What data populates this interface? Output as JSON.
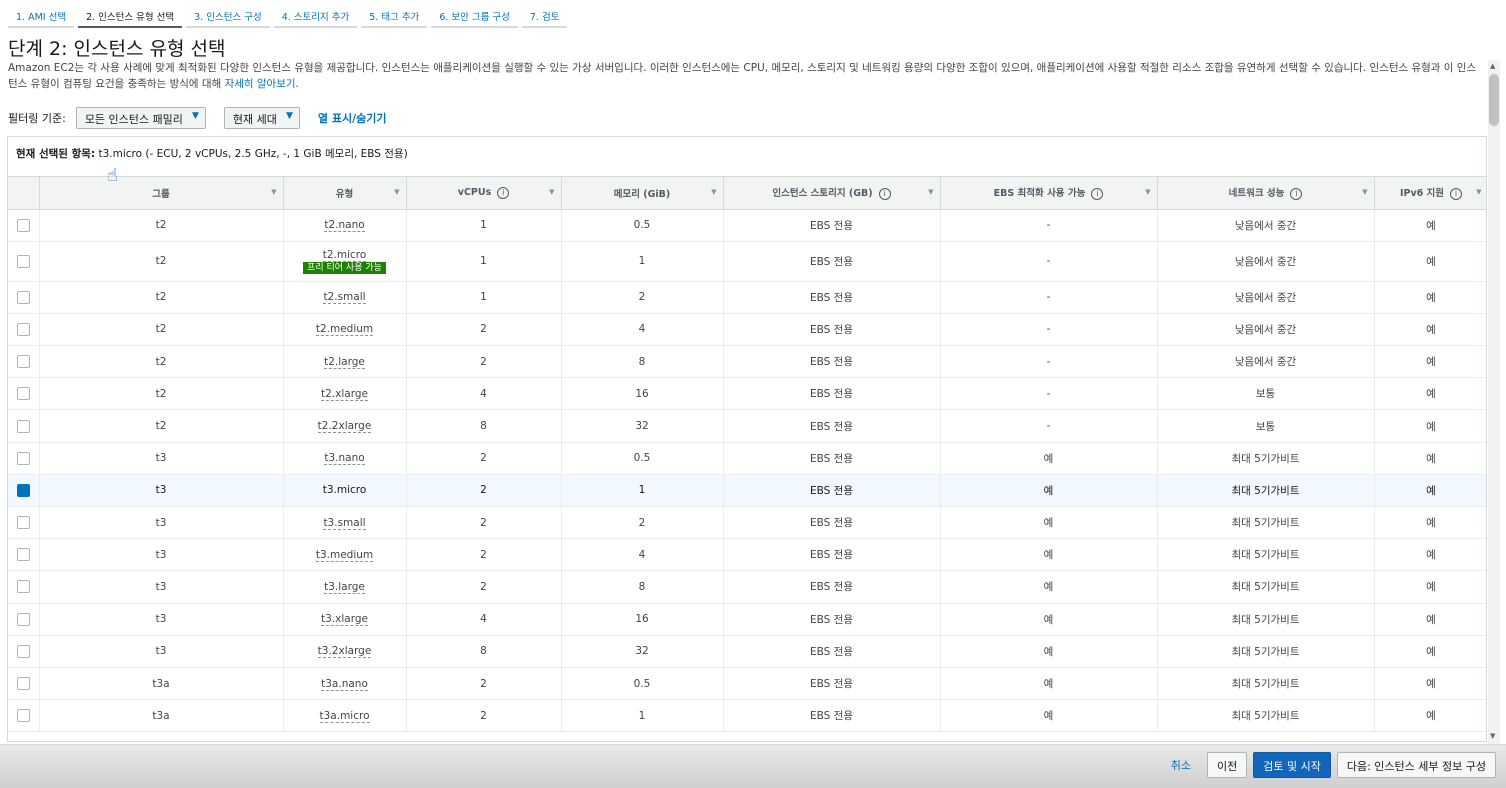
{
  "tabs": [
    "1. AMI 선택",
    "2. 인스턴스 유형 선택",
    "3. 인스턴스 구성",
    "4. 스토리지 추가",
    "5. 태그 추가",
    "6. 보안 그룹 구성",
    "7. 검토"
  ],
  "title": "단계 2: 인스턴스 유형 선택",
  "description": {
    "text": "Amazon EC2는 각 사용 사례에 맞게 최적화된 다양한 인스턴스 유형을 제공합니다. 인스턴스는 애플리케이션을 실행할 수 있는 가상 서버입니다. 이러한 인스턴스에는 CPU, 메모리, 스토리지 및 네트워킹 용량의 다양한 조합이 있으며, 애플리케이션에 사용할 적절한 리소스 조합을 유연하게 선택할 수 있습니다. 인스턴스 유형과 이 인스턴스 유형이 컴퓨팅 요건을 충족하는 방식에 대해 ",
    "link": "자세히 알아보기",
    "tail": "."
  },
  "filter": {
    "label": "필터링 기준:",
    "family": "모든 인스턴스 패밀리",
    "generation": "현재 세대",
    "toggle_columns": "열 표시/숨기기"
  },
  "selection": {
    "label": "현재 선택된 항목:",
    "value": "t3.micro (- ECU, 2 vCPUs, 2.5 GHz, -, 1 GiB 메모리, EBS 전용)"
  },
  "columns": [
    "그룹",
    "유형",
    "vCPUs",
    "메모리 (GiB)",
    "인스턴스 스토리지 (GB)",
    "EBS 최적화 사용 가능",
    "네트워크 성능",
    "IPv6 지원"
  ],
  "info_icon": "i",
  "free_tier_badge": "프리 티어 사용 가능",
  "rows": [
    {
      "group": "t2",
      "type": "t2.nano",
      "vcpus": "1",
      "memory": "0.5",
      "storage": "EBS 전용",
      "ebs": "-",
      "network": "낮음에서 중간",
      "ipv6": "예",
      "selected": false,
      "free": false
    },
    {
      "group": "t2",
      "type": "t2.micro",
      "vcpus": "1",
      "memory": "1",
      "storage": "EBS 전용",
      "ebs": "-",
      "network": "낮음에서 중간",
      "ipv6": "예",
      "selected": false,
      "free": true
    },
    {
      "group": "t2",
      "type": "t2.small",
      "vcpus": "1",
      "memory": "2",
      "storage": "EBS 전용",
      "ebs": "-",
      "network": "낮음에서 중간",
      "ipv6": "예",
      "selected": false,
      "free": false
    },
    {
      "group": "t2",
      "type": "t2.medium",
      "vcpus": "2",
      "memory": "4",
      "storage": "EBS 전용",
      "ebs": "-",
      "network": "낮음에서 중간",
      "ipv6": "예",
      "selected": false,
      "free": false
    },
    {
      "group": "t2",
      "type": "t2.large",
      "vcpus": "2",
      "memory": "8",
      "storage": "EBS 전용",
      "ebs": "-",
      "network": "낮음에서 중간",
      "ipv6": "예",
      "selected": false,
      "free": false
    },
    {
      "group": "t2",
      "type": "t2.xlarge",
      "vcpus": "4",
      "memory": "16",
      "storage": "EBS 전용",
      "ebs": "-",
      "network": "보통",
      "ipv6": "예",
      "selected": false,
      "free": false
    },
    {
      "group": "t2",
      "type": "t2.2xlarge",
      "vcpus": "8",
      "memory": "32",
      "storage": "EBS 전용",
      "ebs": "-",
      "network": "보통",
      "ipv6": "예",
      "selected": false,
      "free": false
    },
    {
      "group": "t3",
      "type": "t3.nano",
      "vcpus": "2",
      "memory": "0.5",
      "storage": "EBS 전용",
      "ebs": "예",
      "network": "최대 5기가비트",
      "ipv6": "예",
      "selected": false,
      "free": false
    },
    {
      "group": "t3",
      "type": "t3.micro",
      "vcpus": "2",
      "memory": "1",
      "storage": "EBS 전용",
      "ebs": "예",
      "network": "최대 5기가비트",
      "ipv6": "예",
      "selected": true,
      "free": false
    },
    {
      "group": "t3",
      "type": "t3.small",
      "vcpus": "2",
      "memory": "2",
      "storage": "EBS 전용",
      "ebs": "예",
      "network": "최대 5기가비트",
      "ipv6": "예",
      "selected": false,
      "free": false
    },
    {
      "group": "t3",
      "type": "t3.medium",
      "vcpus": "2",
      "memory": "4",
      "storage": "EBS 전용",
      "ebs": "예",
      "network": "최대 5기가비트",
      "ipv6": "예",
      "selected": false,
      "free": false
    },
    {
      "group": "t3",
      "type": "t3.large",
      "vcpus": "2",
      "memory": "8",
      "storage": "EBS 전용",
      "ebs": "예",
      "network": "최대 5기가비트",
      "ipv6": "예",
      "selected": false,
      "free": false
    },
    {
      "group": "t3",
      "type": "t3.xlarge",
      "vcpus": "4",
      "memory": "16",
      "storage": "EBS 전용",
      "ebs": "예",
      "network": "최대 5기가비트",
      "ipv6": "예",
      "selected": false,
      "free": false
    },
    {
      "group": "t3",
      "type": "t3.2xlarge",
      "vcpus": "8",
      "memory": "32",
      "storage": "EBS 전용",
      "ebs": "예",
      "network": "최대 5기가비트",
      "ipv6": "예",
      "selected": false,
      "free": false
    },
    {
      "group": "t3a",
      "type": "t3a.nano",
      "vcpus": "2",
      "memory": "0.5",
      "storage": "EBS 전용",
      "ebs": "예",
      "network": "최대 5기가비트",
      "ipv6": "예",
      "selected": false,
      "free": false
    },
    {
      "group": "t3a",
      "type": "t3a.micro",
      "vcpus": "2",
      "memory": "1",
      "storage": "EBS 전용",
      "ebs": "예",
      "network": "최대 5기가비트",
      "ipv6": "예",
      "selected": false,
      "free": false
    }
  ],
  "footer": {
    "cancel": "취소",
    "previous": "이전",
    "review_launch": "검토 및 시작",
    "next": "다음: 인스턴스 세부 정보 구성"
  },
  "colors": {
    "accent": "#0073bb",
    "primary_button": "#1166bb",
    "free_tier": "#1d8102",
    "selected_row": "#f1f8fe"
  }
}
